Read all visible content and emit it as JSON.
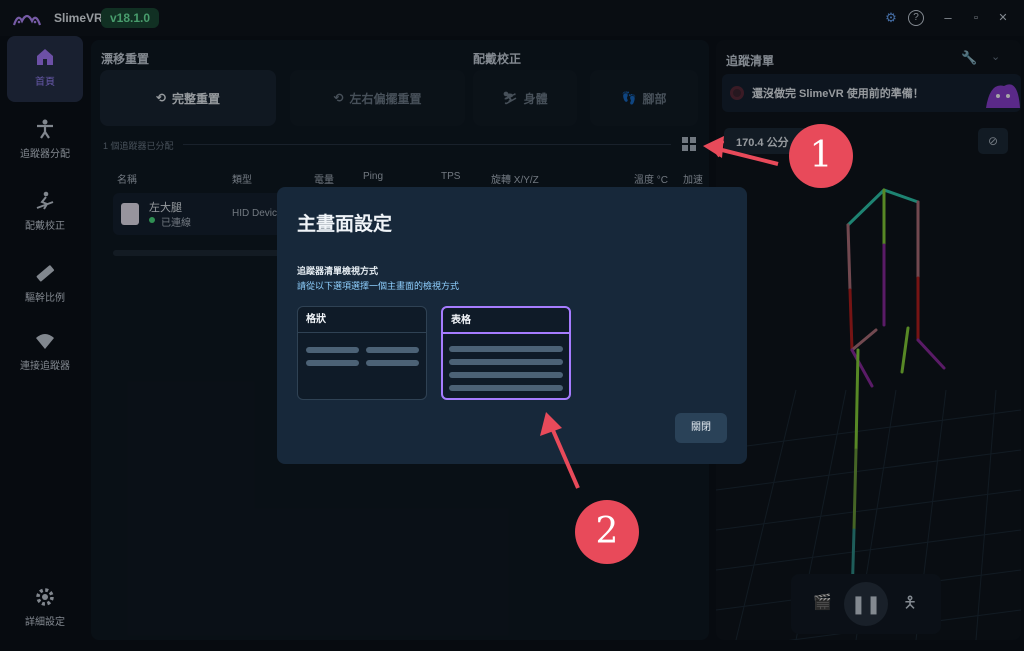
{
  "app": {
    "name": "SlimeVR",
    "version": "v18.1.0"
  },
  "titlebar": {
    "settings_icon": "gear-icon",
    "help_icon": "help-icon",
    "minimize": "–",
    "maximize": "▫",
    "close": "✕"
  },
  "sidebar": {
    "items": [
      {
        "label": "首頁",
        "icon": "home-icon",
        "active": true
      },
      {
        "label": "追蹤器分配",
        "icon": "body-icon"
      },
      {
        "label": "配戴校正",
        "icon": "ski-icon"
      },
      {
        "label": "驅幹比例",
        "icon": "ruler-icon"
      },
      {
        "label": "連接追蹤器",
        "icon": "wifi-icon"
      }
    ],
    "settings_label": "詳細設定"
  },
  "main": {
    "drift_title": "漂移重置",
    "mount_title": "配戴校正",
    "buttons": {
      "full_reset": "完整重置",
      "yaw_reset": "左右偏擺重置",
      "body": "身體",
      "feet": "腳部"
    },
    "assigned_text": "1 個追蹤器已分配",
    "table_headers": [
      "名稱",
      "類型",
      "電量",
      "Ping",
      "TPS",
      "旋轉 X/Y/Z",
      "溫度 °C",
      "加速"
    ],
    "tracker": {
      "name": "左大腿",
      "status": "已連線",
      "type": "HID Devic"
    }
  },
  "right_panel": {
    "title": "追蹤清單",
    "notice": "還沒做完 SlimeVR 使用前的準備！",
    "height": "170.4 公分"
  },
  "modal": {
    "title": "主畫面設定",
    "section_title": "追蹤器清單檢視方式",
    "section_desc": "請從以下選項選擇一個主畫面的檢視方式",
    "options": [
      {
        "label": "格狀",
        "selected": false
      },
      {
        "label": "表格",
        "selected": true
      }
    ],
    "close_label": "關閉"
  },
  "callouts": [
    "1",
    "2"
  ],
  "colors": {
    "accent": "#a67cff",
    "version_bg": "#1b4a36",
    "version_text": "#6ff0a7",
    "callout": "#e84a5a"
  }
}
